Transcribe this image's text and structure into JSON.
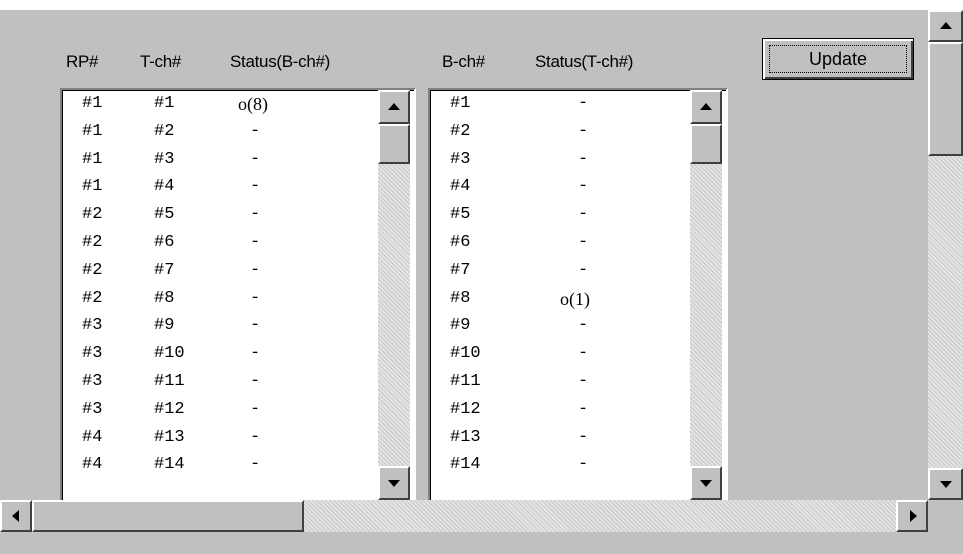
{
  "left_list": {
    "headers": {
      "rp": "RP#",
      "tch": "T-ch#",
      "status": "Status(B-ch#)"
    },
    "rows": [
      {
        "rp": "#1",
        "tch": "#1",
        "status": "o(8)"
      },
      {
        "rp": "#1",
        "tch": "#2",
        "status": "-"
      },
      {
        "rp": "#1",
        "tch": "#3",
        "status": "-"
      },
      {
        "rp": "#1",
        "tch": "#4",
        "status": "-"
      },
      {
        "rp": "#2",
        "tch": "#5",
        "status": "-"
      },
      {
        "rp": "#2",
        "tch": "#6",
        "status": "-"
      },
      {
        "rp": "#2",
        "tch": "#7",
        "status": "-"
      },
      {
        "rp": "#2",
        "tch": "#8",
        "status": "-"
      },
      {
        "rp": "#3",
        "tch": "#9",
        "status": "-"
      },
      {
        "rp": "#3",
        "tch": "#10",
        "status": "-"
      },
      {
        "rp": "#3",
        "tch": "#11",
        "status": "-"
      },
      {
        "rp": "#3",
        "tch": "#12",
        "status": "-"
      },
      {
        "rp": "#4",
        "tch": "#13",
        "status": "-"
      },
      {
        "rp": "#4",
        "tch": "#14",
        "status": "-"
      }
    ]
  },
  "right_list": {
    "headers": {
      "bch": "B-ch#",
      "status": "Status(T-ch#)"
    },
    "rows": [
      {
        "bch": "#1",
        "status": "-"
      },
      {
        "bch": "#2",
        "status": "-"
      },
      {
        "bch": "#3",
        "status": "-"
      },
      {
        "bch": "#4",
        "status": "-"
      },
      {
        "bch": "#5",
        "status": "-"
      },
      {
        "bch": "#6",
        "status": "-"
      },
      {
        "bch": "#7",
        "status": "-"
      },
      {
        "bch": "#8",
        "status": "o(1)"
      },
      {
        "bch": "#9",
        "status": "-"
      },
      {
        "bch": "#10",
        "status": "-"
      },
      {
        "bch": "#11",
        "status": "-"
      },
      {
        "bch": "#12",
        "status": "-"
      },
      {
        "bch": "#13",
        "status": "-"
      },
      {
        "bch": "#14",
        "status": "-"
      }
    ]
  },
  "toolbar": {
    "update_label": "Update"
  },
  "icons": {
    "scroll_up": "arrow-up-icon",
    "scroll_down": "arrow-down-icon",
    "scroll_left": "arrow-left-icon",
    "scroll_right": "arrow-right-icon"
  },
  "colors": {
    "window": "#c0c0c0",
    "list_bg": "#ffffff",
    "text": "#000000"
  }
}
